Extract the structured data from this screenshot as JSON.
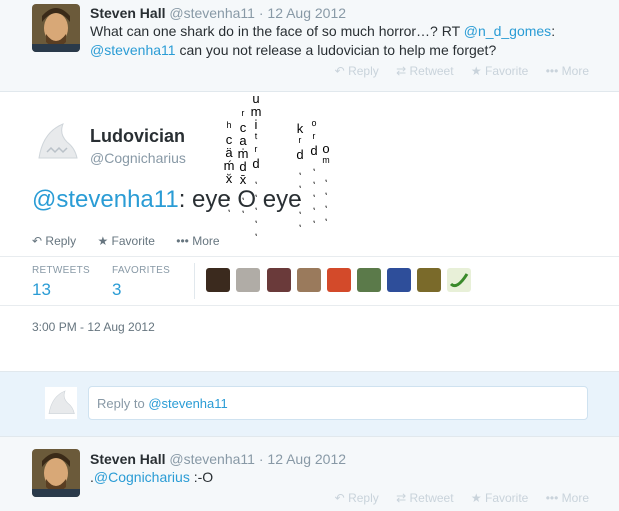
{
  "tweet1": {
    "name": "Steven Hall",
    "handle": "@stevenha11",
    "date": "12 Aug 2012",
    "text_a": "What can one shark do in the face of so much horror…? RT ",
    "mention_a": "@n_d_gomes",
    "text_b": ":",
    "mention_b": "@stevenha11",
    "text_c": " can you not release a ludovician to help me forget?",
    "actions": {
      "reply": "Reply",
      "retweet": "Retweet",
      "favorite": "Favorite",
      "more": "More"
    }
  },
  "main": {
    "name": "Ludovician",
    "handle": "@Cognicharius",
    "mention": "@stevenha11",
    "text": ": eye O eye",
    "actions": {
      "reply": "Reply",
      "favorite": "Favorite",
      "more": "More"
    },
    "stats": {
      "retweets_label": "RETWEETS",
      "retweets": "13",
      "favorites_label": "FAVORITES",
      "favorites": "3"
    },
    "timestamp": "3:00 PM - 12 Aug 2012"
  },
  "reply_box": {
    "placeholder_prefix": "Reply to ",
    "placeholder_mention": "@stevenha11"
  },
  "tweet2": {
    "name": "Steven Hall",
    "handle": "@stevenha11",
    "date": "12 Aug 2012",
    "prefix": ".",
    "mention": "@Cognicharius",
    "text": " :-O",
    "actions": {
      "reply": "Reply",
      "retweet": "Retweet",
      "favorite": "Favorite",
      "more": "More"
    }
  },
  "colors": {
    "link": "#2a9cd5",
    "muted": "#8899a6",
    "bg_light": "#f5f8fa",
    "reply_bg": "#e9f3fb"
  }
}
